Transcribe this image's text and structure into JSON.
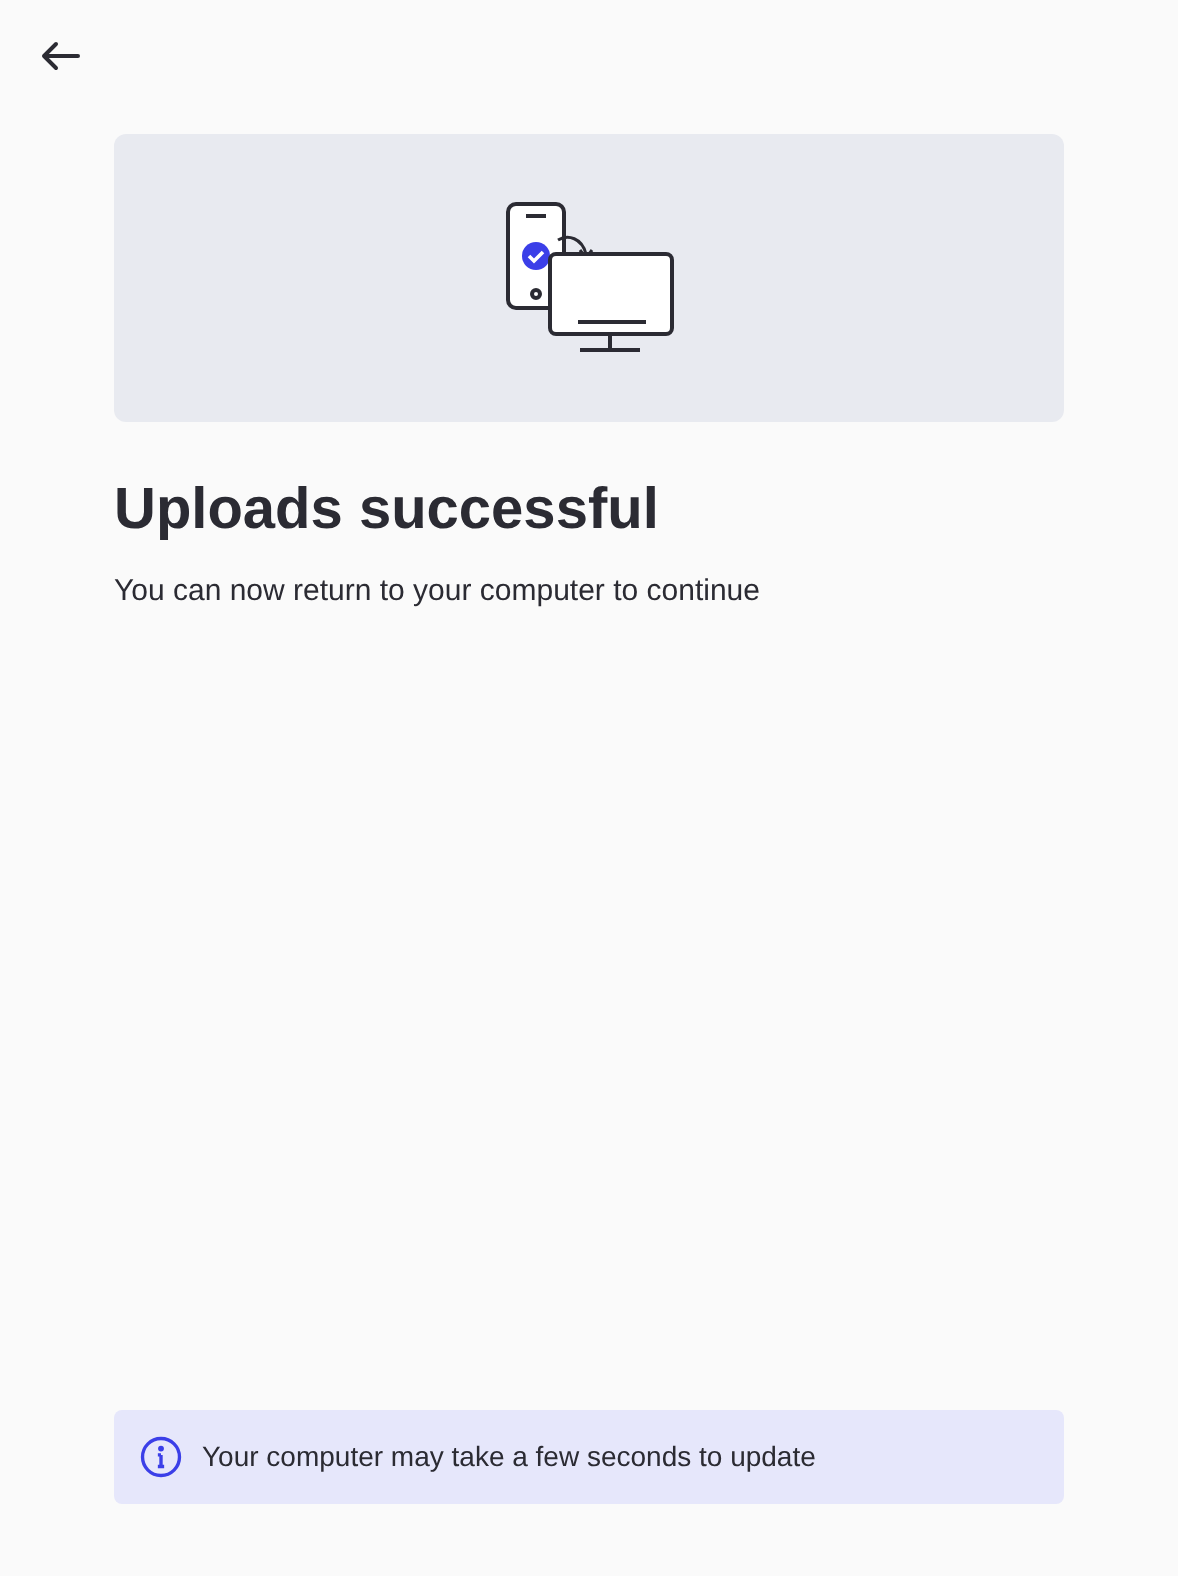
{
  "title": "Uploads successful",
  "message": "You can now return to your computer to continue",
  "notice": {
    "text": "Your computer may take a few seconds to update"
  }
}
